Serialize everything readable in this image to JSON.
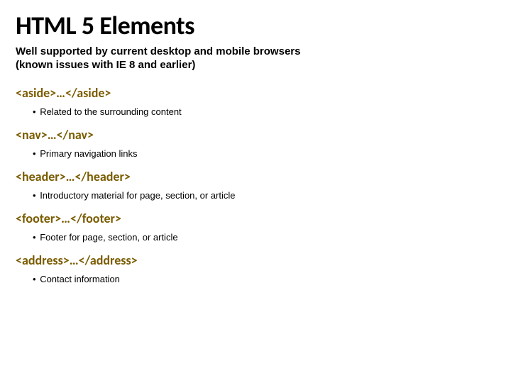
{
  "title": "HTML 5 Elements",
  "subtitle_line1": "Well supported by current desktop and mobile browsers",
  "subtitle_line2": "(known issues with IE 8 and earlier)",
  "elements": [
    {
      "tag": "<aside>…</aside>",
      "desc": "Related to the surrounding content"
    },
    {
      "tag": "<nav>…</nav>",
      "desc": "Primary navigation links"
    },
    {
      "tag": "<header>…</header>",
      "desc": "Introductory material for page, section, or article"
    },
    {
      "tag": "<footer>…</footer>",
      "desc": "Footer for page, section, or article"
    },
    {
      "tag": "<address>…</address>",
      "desc": "Contact information"
    }
  ]
}
